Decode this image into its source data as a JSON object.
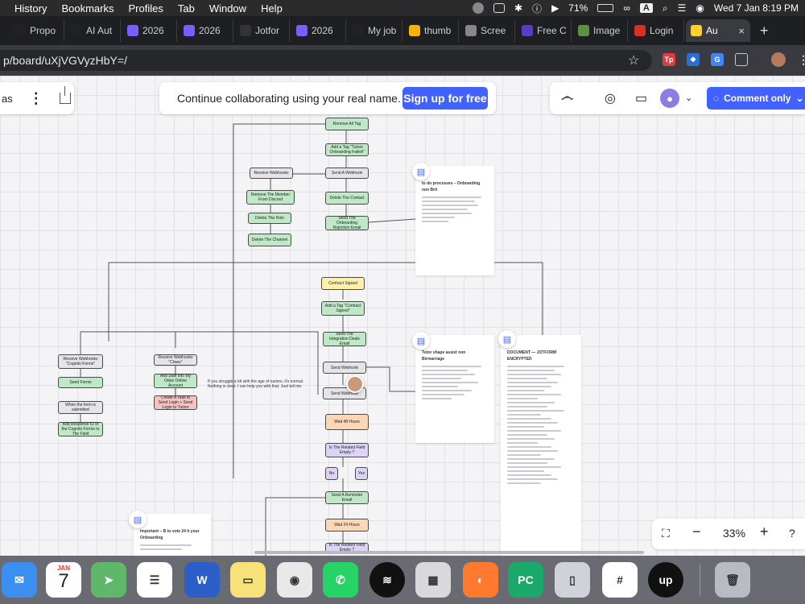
{
  "menubar": {
    "items": [
      "History",
      "Bookmarks",
      "Profiles",
      "Tab",
      "Window",
      "Help"
    ],
    "battery": "71%",
    "input_source": "A",
    "clock": "Wed 7 Jan  8:19 PM"
  },
  "tabs": [
    {
      "label": "Propo",
      "icon": "upwork-icon",
      "color": "#222222"
    },
    {
      "label": "AI Aut",
      "icon": "upwork-icon",
      "color": "#222222"
    },
    {
      "label": "2026",
      "icon": "clickup-icon",
      "color": "#7b5cff"
    },
    {
      "label": "2026",
      "icon": "clickup-icon",
      "color": "#7b5cff"
    },
    {
      "label": "Jotfor",
      "icon": "jotform-icon",
      "color": "#333333"
    },
    {
      "label": "2026",
      "icon": "clickup-icon",
      "color": "#7b5cff"
    },
    {
      "label": "My job",
      "icon": "upwork-icon",
      "color": "#222222"
    },
    {
      "label": "thumb",
      "icon": "drive-icon",
      "color": "#f4b400"
    },
    {
      "label": "Scree",
      "icon": "chrome-icon",
      "color": "#888888"
    },
    {
      "label": "Free C",
      "icon": "purple-app-icon",
      "color": "#5b3cc4"
    },
    {
      "label": "Image",
      "icon": "shopify-icon",
      "color": "#5e8e3e"
    },
    {
      "label": "Login",
      "icon": "red-app-icon",
      "color": "#d93025"
    },
    {
      "label": "Au",
      "icon": "miro-icon",
      "color": "#ffd02f",
      "active": true
    }
  ],
  "address": {
    "url": "p/board/uXjVGVyzHbY=/"
  },
  "board": {
    "left_toolbar_text": "as",
    "banner_text": "Continue collaborating using your real name.",
    "signup_label": "Sign up for free",
    "comment_label": "Comment only",
    "zoom_level": "33%"
  },
  "nodes": {
    "remove_all_tag": "Remove All Tag",
    "add_tag_failed": "Add a Tag \"Tutors Onboarding Failed\"",
    "send_webhook_1": "Send A Webhook",
    "delete_contact": "Delete The Contact",
    "send_rejection": "Send The Onboarding Rejection Email",
    "receive_webhooks": "Receive Webhooks",
    "remove_member": "Remove The Member From Discord",
    "delete_role": "Delete The Role",
    "delete_channel": "Delete The Channel",
    "contract_signed": "Contract Signed",
    "add_tag_contract": "Add a Tag \"Contract Signed\"",
    "send_integration": "Send The Integration Deals Email",
    "send_webhook_2": "Send Webhook",
    "send_webhook_3": "Send Webhook",
    "wait_48": "Wait 48 Hours",
    "related_field_1": "Is The Related Field Empty ?",
    "no_label": "No",
    "yes_label": "Yes",
    "send_reminder": "Send A Reminder Email",
    "wait_24": "Wait 24 Hours",
    "related_field_2": "Is The Related Field Empty ?",
    "receive_cognito": "Receive Webhooks \"Cognito Forms\"",
    "send_forms": "Send Forms",
    "when_form": "When the form is submitted",
    "add_response": "Add Response ID of the Cognito Forms to The Field",
    "receive_claws": "Receive Webhooks \"Claws\"",
    "add_staff": "Add Staff Into My Odoo Online Account",
    "create_task": "Create A Task to Send Login + Send Login to Tutors"
  },
  "docs": {
    "doc1_title": "to do processes – Onboarding non Brit",
    "doc2_title": "Tutor shape assist non Birmarriage",
    "doc3_title": "DOCUMENT — JOTFORM ENCRYPTED",
    "doc4_title": "Important – B to vote 24 h your Onboarding"
  },
  "sticky_note": "If you struggle a bit with the age of names, it's normal. Nothing is clear. I can help you with that. Just tell me.",
  "dock": {
    "calendar_month": "JAN",
    "calendar_day": "7",
    "apps": [
      "mail-icon",
      "calendar-icon",
      "maps-icon",
      "reminders-icon",
      "word-icon",
      "notes-icon",
      "chrome-icon",
      "whatsapp-icon",
      "spotify-icon",
      "calculator-icon",
      "firefox-icon",
      "pycharm-icon",
      "iphone-mirroring-icon",
      "slack-icon",
      "upwork-icon",
      "trash-icon"
    ]
  }
}
